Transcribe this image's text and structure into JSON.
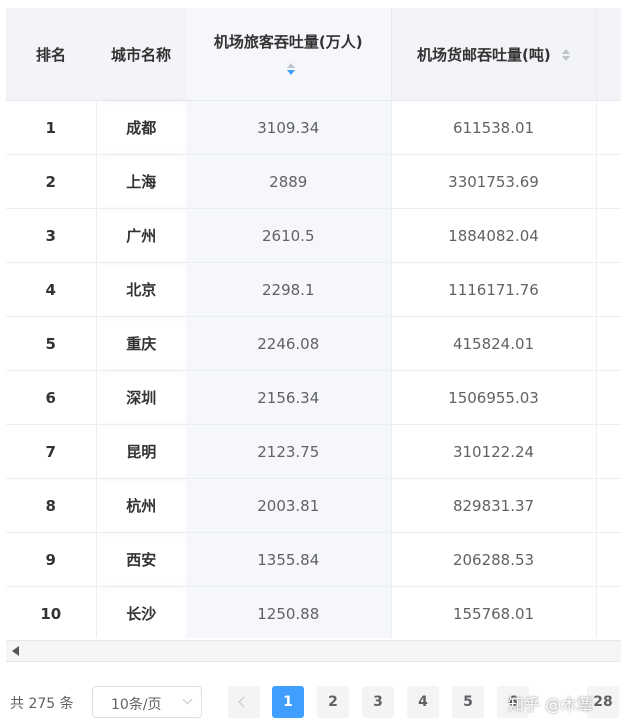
{
  "table": {
    "headers": {
      "rank": "排名",
      "city": "城市名称",
      "passenger": "机场旅客吞吐量(万人)",
      "cargo": "机场货邮吞吐量(吨)"
    },
    "sort": {
      "column": "passenger",
      "order": "descending",
      "active_color": "#409eff"
    },
    "rows": [
      {
        "rank": "1",
        "city": "成都",
        "passenger": "3109.34",
        "cargo": "611538.01"
      },
      {
        "rank": "2",
        "city": "上海",
        "passenger": "2889",
        "cargo": "3301753.69"
      },
      {
        "rank": "3",
        "city": "广州",
        "passenger": "2610.5",
        "cargo": "1884082.04"
      },
      {
        "rank": "4",
        "city": "北京",
        "passenger": "2298.1",
        "cargo": "1116171.76"
      },
      {
        "rank": "5",
        "city": "重庆",
        "passenger": "2246.08",
        "cargo": "415824.01"
      },
      {
        "rank": "6",
        "city": "深圳",
        "passenger": "2156.34",
        "cargo": "1506955.03"
      },
      {
        "rank": "7",
        "city": "昆明",
        "passenger": "2123.75",
        "cargo": "310122.24"
      },
      {
        "rank": "8",
        "city": "杭州",
        "passenger": "2003.81",
        "cargo": "829831.37"
      },
      {
        "rank": "9",
        "city": "西安",
        "passenger": "1355.84",
        "cargo": "206288.53"
      },
      {
        "rank": "10",
        "city": "长沙",
        "passenger": "1250.88",
        "cargo": "155768.01"
      }
    ]
  },
  "pagination": {
    "total_text": "共 275 条",
    "page_size": "10条/页",
    "pages": [
      "1",
      "2",
      "3",
      "4",
      "5",
      "6"
    ],
    "current_page": "1",
    "last_page": "28"
  },
  "watermark": "知乎 @木蕈",
  "icons": {
    "sort": "sort-caret-icon",
    "scroll_left": "scroll-left-arrow-icon",
    "prev": "chevron-left-icon",
    "dropdown": "chevron-down-icon"
  }
}
